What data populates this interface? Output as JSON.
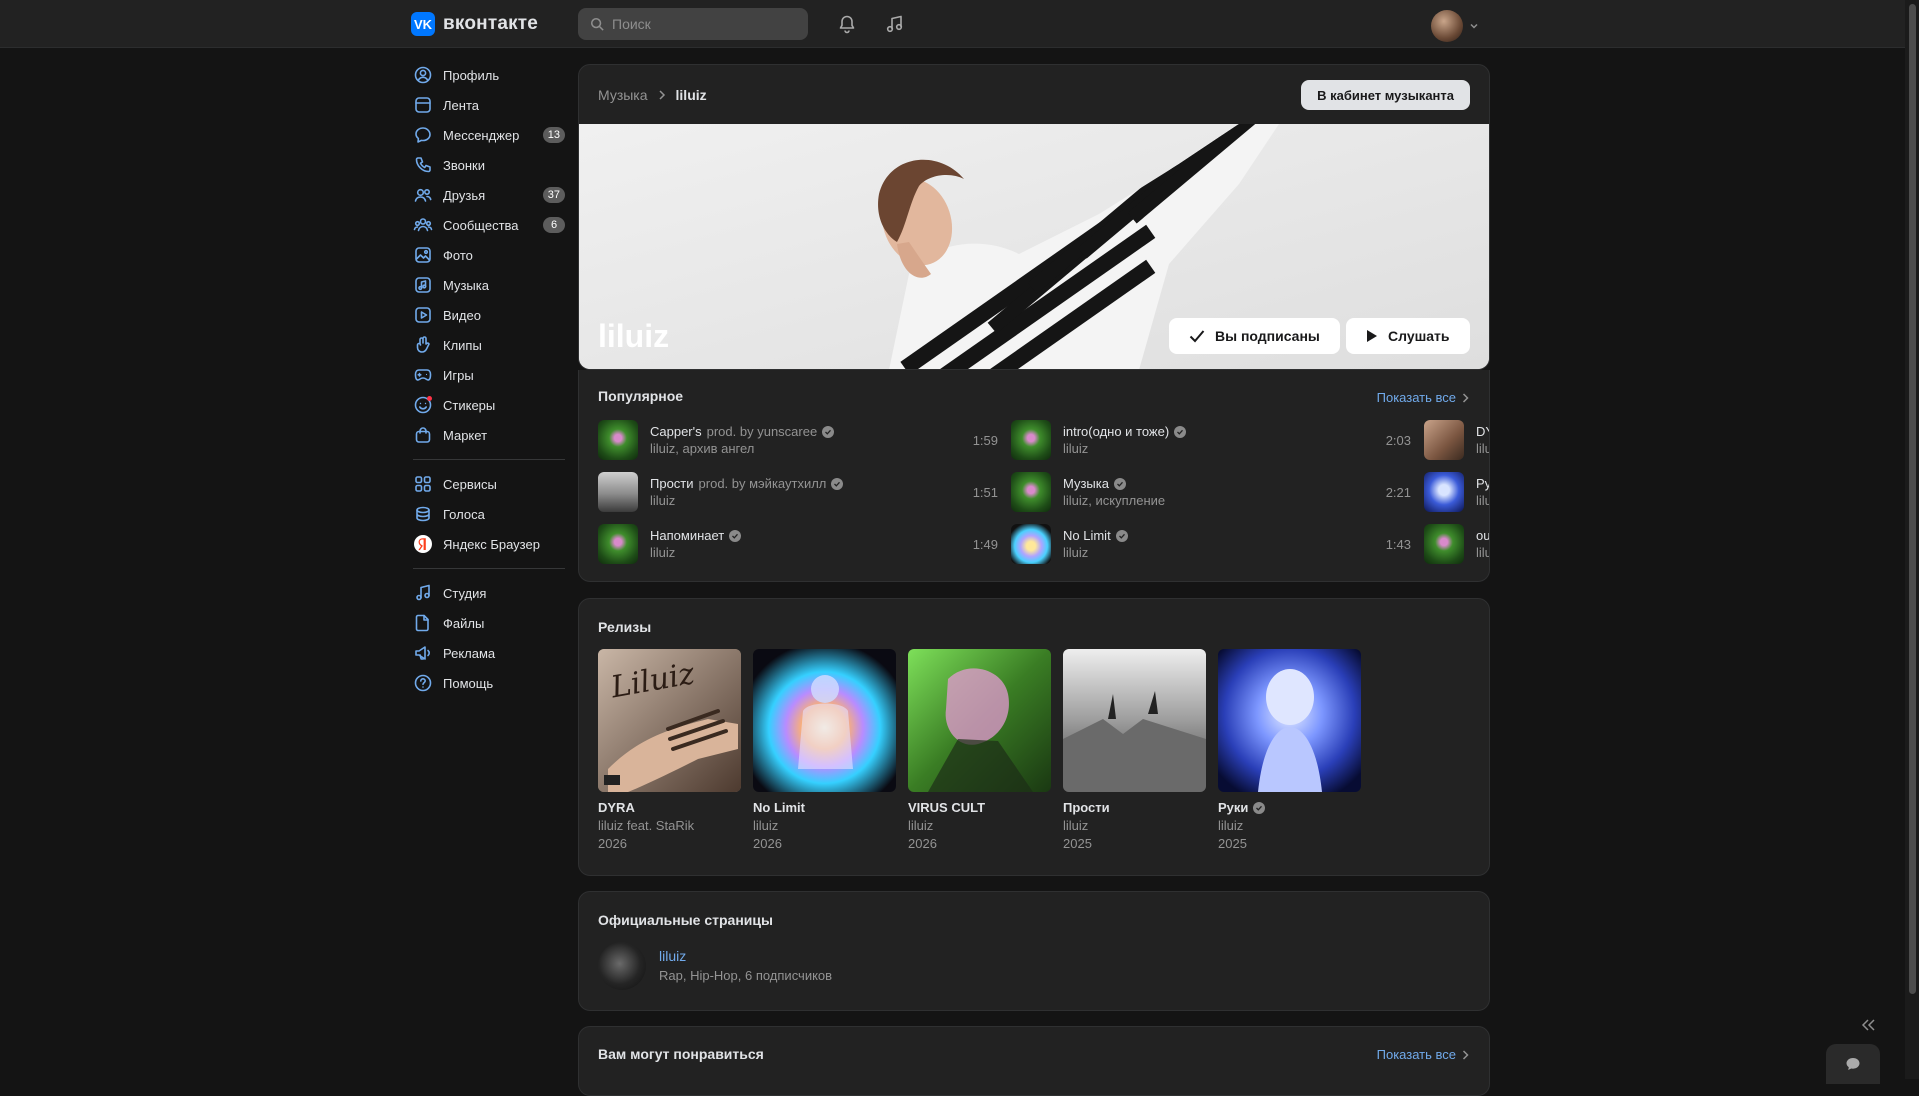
{
  "header": {
    "logo_mark": "VK",
    "logo_text": "вконтакте",
    "search_placeholder": "Поиск"
  },
  "sidebar": {
    "groups": [
      [
        {
          "name": "profile",
          "icon": "user-circle-icon",
          "label": "Профиль"
        },
        {
          "name": "feed",
          "icon": "news-icon",
          "label": "Лента"
        },
        {
          "name": "messenger",
          "icon": "chat-bubble-icon",
          "label": "Мессенджер",
          "badge": "13"
        },
        {
          "name": "calls",
          "icon": "phone-icon",
          "label": "Звонки"
        },
        {
          "name": "friends",
          "icon": "users-icon",
          "label": "Друзья",
          "badge": "37"
        },
        {
          "name": "communities",
          "icon": "group-icon",
          "label": "Сообщества",
          "badge": "6"
        },
        {
          "name": "photos",
          "icon": "image-icon",
          "label": "Фото"
        },
        {
          "name": "music",
          "icon": "music-icon",
          "label": "Музыка"
        },
        {
          "name": "video",
          "icon": "video-icon",
          "label": "Видео"
        },
        {
          "name": "clips",
          "icon": "clip-icon",
          "label": "Клипы"
        },
        {
          "name": "games",
          "icon": "gamepad-icon",
          "label": "Игры"
        },
        {
          "name": "stickers",
          "icon": "smile-icon",
          "label": "Стикеры",
          "dot": true
        },
        {
          "name": "market",
          "icon": "bag-icon",
          "label": "Маркет"
        }
      ],
      [
        {
          "name": "services",
          "icon": "grid-icon",
          "label": "Сервисы"
        },
        {
          "name": "voices",
          "icon": "coins-icon",
          "label": "Голоса"
        },
        {
          "name": "yandex-browser",
          "icon": "yandex-icon",
          "label": "Яндекс Браузер"
        }
      ],
      [
        {
          "name": "studio",
          "icon": "music-note-icon",
          "label": "Студия"
        },
        {
          "name": "files",
          "icon": "file-icon",
          "label": "Файлы"
        },
        {
          "name": "ads",
          "icon": "megaphone-icon",
          "label": "Реклама"
        },
        {
          "name": "help",
          "icon": "question-icon",
          "label": "Помощь"
        }
      ]
    ]
  },
  "artist": {
    "breadcrumb_root": "Музыка",
    "breadcrumb_current": "liluiz",
    "cabinet_button": "В кабинет музыканта",
    "name": "liluiz",
    "subscribed_button": "Вы подписаны",
    "listen_button": "Слушать"
  },
  "popular": {
    "title": "Популярное",
    "show_all": "Показать все",
    "tracks": [
      {
        "title": "Capper's",
        "prod": "prod. by yunscaree",
        "verified": true,
        "artist": "liluiz, архив ангел",
        "duration": "1:59",
        "thumb": "green"
      },
      {
        "title": "Прости",
        "prod": "prod. by мэйкаутхилл",
        "verified": true,
        "artist": "liluiz",
        "duration": "1:51",
        "thumb": "grey"
      },
      {
        "title": "Напоминает",
        "prod": "",
        "verified": true,
        "artist": "liluiz",
        "duration": "1:49",
        "thumb": "green"
      },
      {
        "title": "intro(одно и тоже)",
        "prod": "",
        "verified": true,
        "artist": "liluiz",
        "duration": "2:03",
        "thumb": "green"
      },
      {
        "title": "Музыка",
        "prod": "",
        "verified": true,
        "artist": "liluiz, искупление",
        "duration": "2:21",
        "thumb": "green"
      },
      {
        "title": "No Limit",
        "prod": "",
        "verified": true,
        "artist": "liluiz",
        "duration": "1:43",
        "thumb": "rainbow"
      },
      {
        "title": "DY",
        "prod": "",
        "verified": false,
        "artist": "lilu",
        "duration": "",
        "thumb": "brown"
      },
      {
        "title": "Ру",
        "prod": "",
        "verified": false,
        "artist": "lilu",
        "duration": "",
        "thumb": "blue"
      },
      {
        "title": "ou",
        "prod": "",
        "verified": false,
        "artist": "lilu",
        "duration": "",
        "thumb": "green"
      }
    ]
  },
  "releases": {
    "title": "Релизы",
    "items": [
      {
        "title": "DYRA",
        "verified": false,
        "artist": "liluiz feat. StaRik",
        "year": "2026",
        "art": "dyra"
      },
      {
        "title": "No Limit",
        "verified": false,
        "artist": "liluiz",
        "year": "2026",
        "art": "nolimit"
      },
      {
        "title": "VIRUS CULT",
        "verified": false,
        "artist": "liluiz",
        "year": "2026",
        "art": "virus"
      },
      {
        "title": "Прости",
        "verified": false,
        "artist": "liluiz",
        "year": "2025",
        "art": "prosti"
      },
      {
        "title": "Руки",
        "verified": true,
        "artist": "liluiz",
        "year": "2025",
        "art": "ruki"
      }
    ]
  },
  "official": {
    "title": "Официальные страницы",
    "name": "liluiz",
    "meta": "Rap, Hip-Hop, 6 подписчиков"
  },
  "recommend": {
    "title": "Вам могут понравиться",
    "show_all": "Показать все"
  },
  "colors": {
    "accent": "#0077ff",
    "link": "#71aaeb",
    "background": "#141414",
    "card": "#222222"
  }
}
